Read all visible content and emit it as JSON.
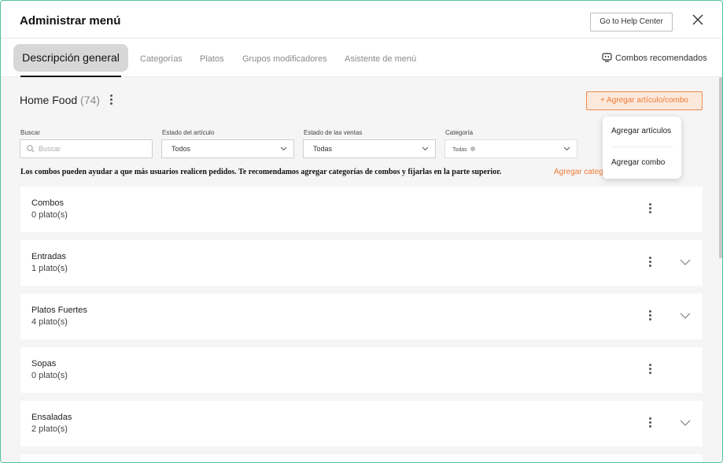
{
  "header": {
    "title": "Administrar menú",
    "help_button": "Go to Help Center"
  },
  "tabs": {
    "items": [
      {
        "label": "Descripción general",
        "active": true
      },
      {
        "label": "Categorías",
        "active": false
      },
      {
        "label": "Platos",
        "active": false
      },
      {
        "label": "Grupos modificadores",
        "active": false
      },
      {
        "label": "Asistente de menú",
        "active": false
      }
    ],
    "combos_recommended": "Combos recomendados"
  },
  "store": {
    "name": "Home Food",
    "count": "(74)"
  },
  "add_button": "+ Agregar artículo/combo",
  "filters": {
    "search_label": "Buscar",
    "search_placeholder": "Buscar",
    "item_status_label": "Estado del artículo",
    "item_status_value": "Todos",
    "sales_status_label": "Estado de las ventas",
    "sales_status_value": "Todas",
    "category_label": "Categoría",
    "category_tag": "Todas"
  },
  "notice": {
    "text": "Los combos pueden ayudar a que más usuarios realicen pedidos. Te recomendamos agregar categorías de combos y fijarlas en la parte superior.",
    "link": "Agregar categoría"
  },
  "dropdown": {
    "items": [
      "Agregar artículos",
      "Agregar combo"
    ]
  },
  "categories": [
    {
      "name": "Combos",
      "count": "0 plato(s)",
      "expandable": false
    },
    {
      "name": "Entradas",
      "count": "1 plato(s)",
      "expandable": true
    },
    {
      "name": "Platos Fuertes",
      "count": "4 plato(s)",
      "expandable": true
    },
    {
      "name": "Sopas",
      "count": "0 plato(s)",
      "expandable": false
    },
    {
      "name": "Ensaladas",
      "count": "2 plato(s)",
      "expandable": true
    }
  ],
  "colors": {
    "accent": "#f07a35",
    "accent_bg": "#fde9dc",
    "frame_border": "#4fc3a1",
    "content_bg": "#f5f5f5"
  }
}
